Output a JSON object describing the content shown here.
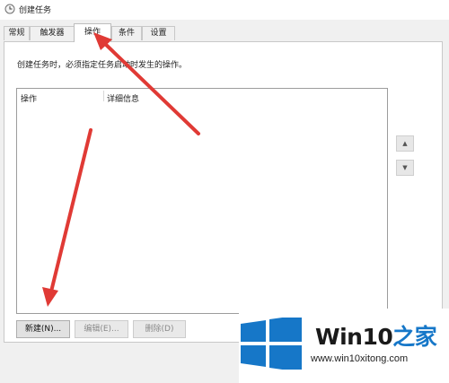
{
  "window": {
    "title": "创建任务"
  },
  "tabs": [
    {
      "label": "常规"
    },
    {
      "label": "触发器"
    },
    {
      "label": "操作"
    },
    {
      "label": "条件"
    },
    {
      "label": "设置"
    }
  ],
  "actions_tab": {
    "description": "创建任务时，必须指定任务启动时发生的操作。",
    "columns": [
      "操作",
      "详细信息"
    ],
    "rows": [],
    "move_up": "▲",
    "move_down": "▼",
    "buttons": {
      "new": "新建(N)...",
      "edit": "编辑(E)...",
      "delete": "删除(D)"
    }
  },
  "watermark": {
    "brand": "Win10",
    "suffix": "之家",
    "url": "www.win10xitong.com"
  },
  "colors": {
    "arrow": "#e03a35",
    "logo_blue": "#1677c8",
    "window_bg": "#f0f0f0"
  }
}
